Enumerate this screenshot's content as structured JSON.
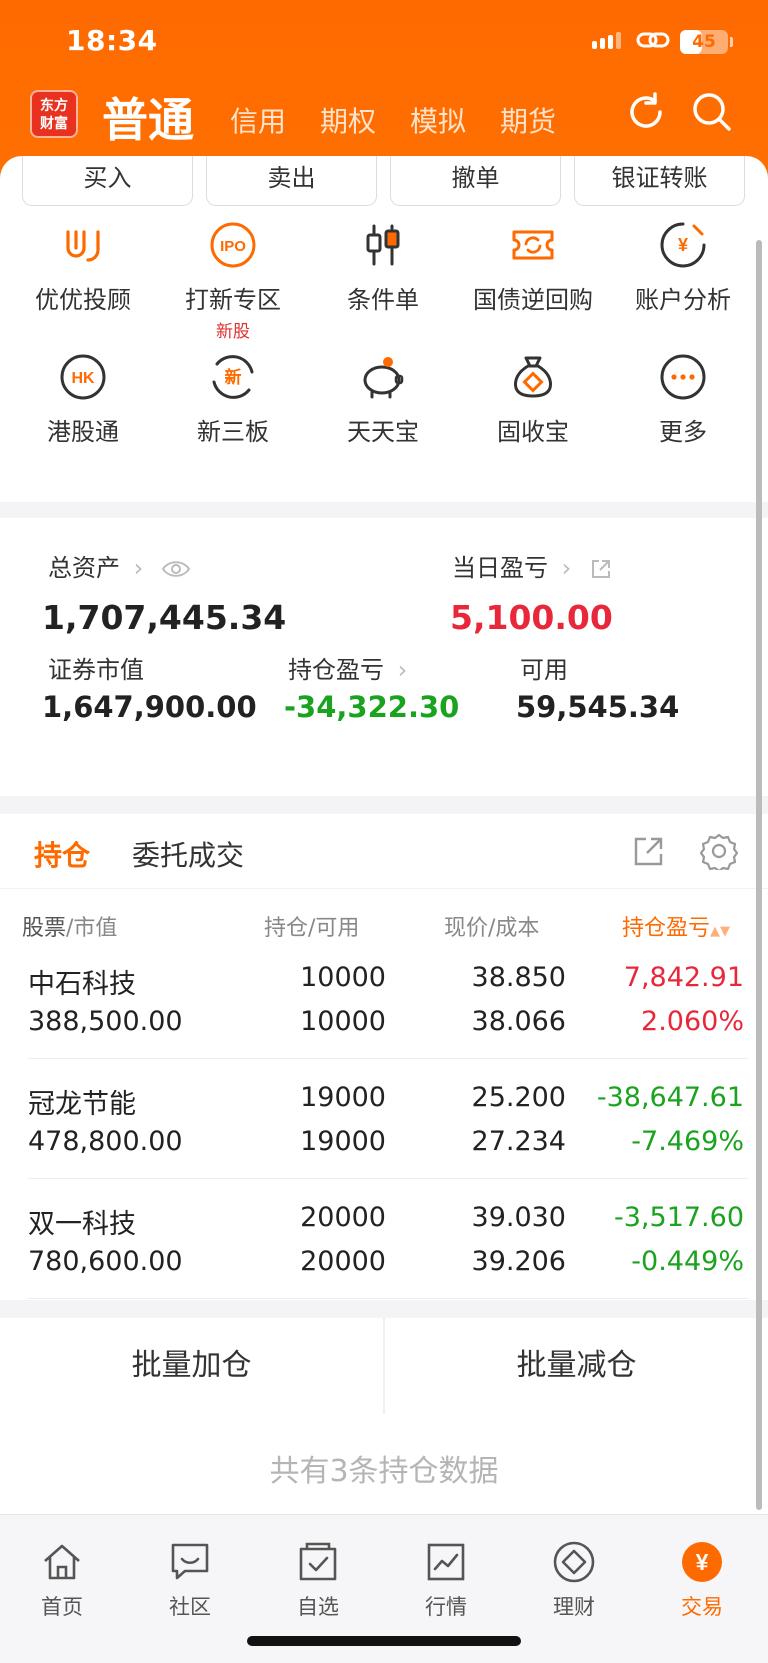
{
  "status_bar": {
    "time": "18:34",
    "battery": "45",
    "battery_level_percent": 45
  },
  "nav": {
    "logo_line1": "东方",
    "logo_line2": "财富",
    "active": "普通",
    "tabs": [
      "信用",
      "期权",
      "模拟",
      "期货"
    ],
    "icons": [
      "refresh-icon",
      "search-icon"
    ]
  },
  "actions": [
    "买入",
    "卖出",
    "撤单",
    "银证转账"
  ],
  "tools": [
    {
      "label": "优优投顾",
      "icon": "youyou-icon"
    },
    {
      "label": "打新专区",
      "icon": "ipo-icon",
      "sub": "新股",
      "icon_text": "IPO"
    },
    {
      "label": "条件单",
      "icon": "candlestick-icon"
    },
    {
      "label": "国债逆回购",
      "icon": "ticket-refresh-icon"
    },
    {
      "label": "账户分析",
      "icon": "yen-chart-icon",
      "icon_text": "¥"
    },
    {
      "label": "港股通",
      "icon": "hk-icon",
      "icon_text": "HK"
    },
    {
      "label": "新三板",
      "icon": "new-board-icon",
      "icon_text": "新"
    },
    {
      "label": "天天宝",
      "icon": "piggy-bank-icon"
    },
    {
      "label": "固收宝",
      "icon": "money-bag-icon"
    },
    {
      "label": "更多",
      "icon": "more-icon"
    }
  ],
  "assets": {
    "total_label": "总资产",
    "total_value": "1,707,445.34",
    "daily_label": "当日盈亏",
    "daily_value": "5,100.00",
    "market_label": "证券市值",
    "market_value": "1,647,900.00",
    "position_pl_label": "持仓盈亏",
    "position_pl_value": "-34,322.30",
    "available_label": "可用",
    "available_value": "59,545.34"
  },
  "holdings": {
    "tab_active": "持仓",
    "tab_other": "委托成交",
    "headers": {
      "stock": "股票",
      "stock_sub": "/市值",
      "position": "持仓",
      "position_sub": "/可用",
      "price": "现价",
      "price_sub": "/成本",
      "pl": "持仓盈亏"
    },
    "rows": [
      {
        "name": "中石科技",
        "market_value": "388,500.00",
        "position": "10000",
        "available": "10000",
        "price": "38.850",
        "cost": "38.066",
        "pl": "7,842.91",
        "pl_pct": "2.060%",
        "trend": "up"
      },
      {
        "name": "冠龙节能",
        "market_value": "478,800.00",
        "position": "19000",
        "available": "19000",
        "price": "25.200",
        "cost": "27.234",
        "pl": "-38,647.61",
        "pl_pct": "-7.469%",
        "trend": "down"
      },
      {
        "name": "双一科技",
        "market_value": "780,600.00",
        "position": "20000",
        "available": "20000",
        "price": "39.030",
        "cost": "39.206",
        "pl": "-3,517.60",
        "pl_pct": "-0.449%",
        "trend": "down"
      }
    ]
  },
  "batch": {
    "add": "批量加仓",
    "reduce": "批量减仓"
  },
  "footer_note": "共有3条持仓数据",
  "tabbar": [
    {
      "label": "首页",
      "icon": "home-icon"
    },
    {
      "label": "社区",
      "icon": "chat-icon"
    },
    {
      "label": "自选",
      "icon": "watchlist-icon"
    },
    {
      "label": "行情",
      "icon": "market-chart-icon"
    },
    {
      "label": "理财",
      "icon": "diamond-icon"
    },
    {
      "label": "交易",
      "icon": "trade-yen-icon",
      "icon_text": "¥",
      "active": true
    }
  ],
  "colors": {
    "brand": "#ff6a00",
    "up": "#e8283a",
    "down": "#1aa31f"
  }
}
